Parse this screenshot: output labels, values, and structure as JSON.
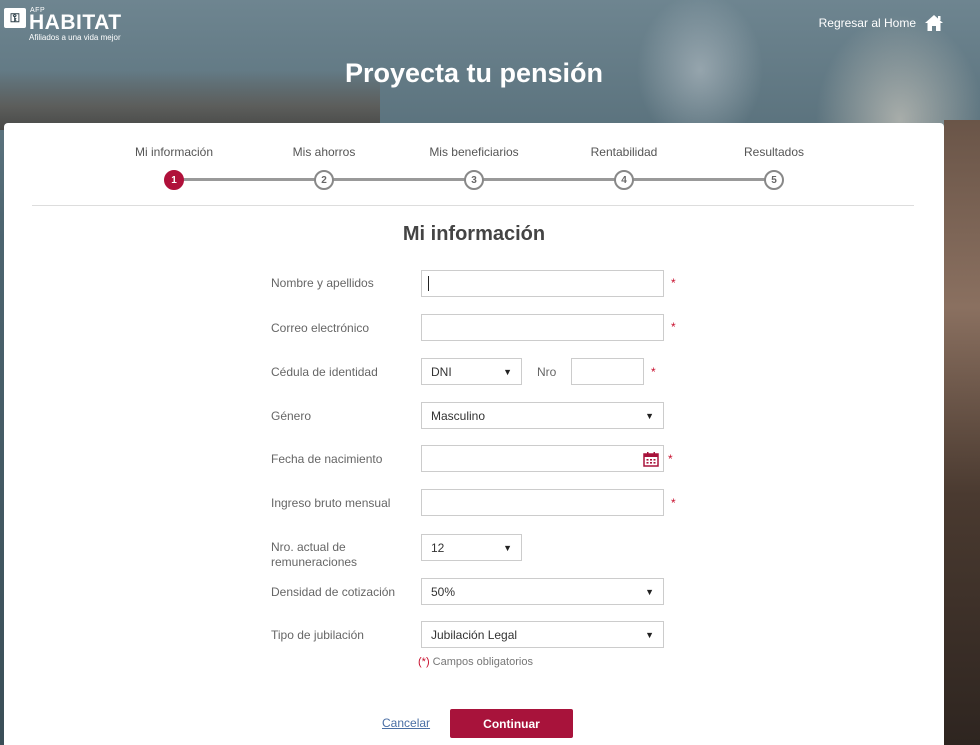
{
  "header": {
    "logo_mark": "⚿",
    "logo_afp": "AFP",
    "logo_name": "HABITAT",
    "logo_tagline": "Afiliados a una vida mejor",
    "home_link": "Regresar al Home",
    "home_icon": "home-icon",
    "page_title": "Proyecta tu pensión"
  },
  "stepper": {
    "steps": [
      {
        "label": "Mi información",
        "number": "1",
        "active": true
      },
      {
        "label": "Mis ahorros",
        "number": "2",
        "active": false
      },
      {
        "label": "Mis beneficiarios",
        "number": "3",
        "active": false
      },
      {
        "label": "Rentabilidad",
        "number": "4",
        "active": false
      },
      {
        "label": "Resultados",
        "number": "5",
        "active": false
      }
    ]
  },
  "form": {
    "title": "Mi información",
    "name_label": "Nombre y apellidos",
    "name_value": "",
    "email_label": "Correo electrónico",
    "email_value": "",
    "id_label": "Cédula de identidad",
    "id_type_value": "DNI",
    "id_number_label": "Nro",
    "id_number_value": "",
    "gender_label": "Género",
    "gender_value": "Masculino",
    "birth_label": "Fecha de nacimiento",
    "birth_value": "",
    "income_label": "Ingreso bruto mensual",
    "income_value": "",
    "remun_label_line1": "Nro. actual de",
    "remun_label_line2": "remuneraciones",
    "remun_value": "12",
    "density_label": "Densidad de cotización",
    "density_value": "50%",
    "retirement_label": "Tipo de jubilación",
    "retirement_value": "Jubilación Legal",
    "required_mark": "*",
    "required_note_star": "(*)",
    "required_note_text": " Campos obligatorios"
  },
  "actions": {
    "cancel": "Cancelar",
    "continue": "Continuar"
  },
  "colors": {
    "accent": "#a8133b",
    "required": "#c8102e",
    "link": "#4a6fa5"
  }
}
